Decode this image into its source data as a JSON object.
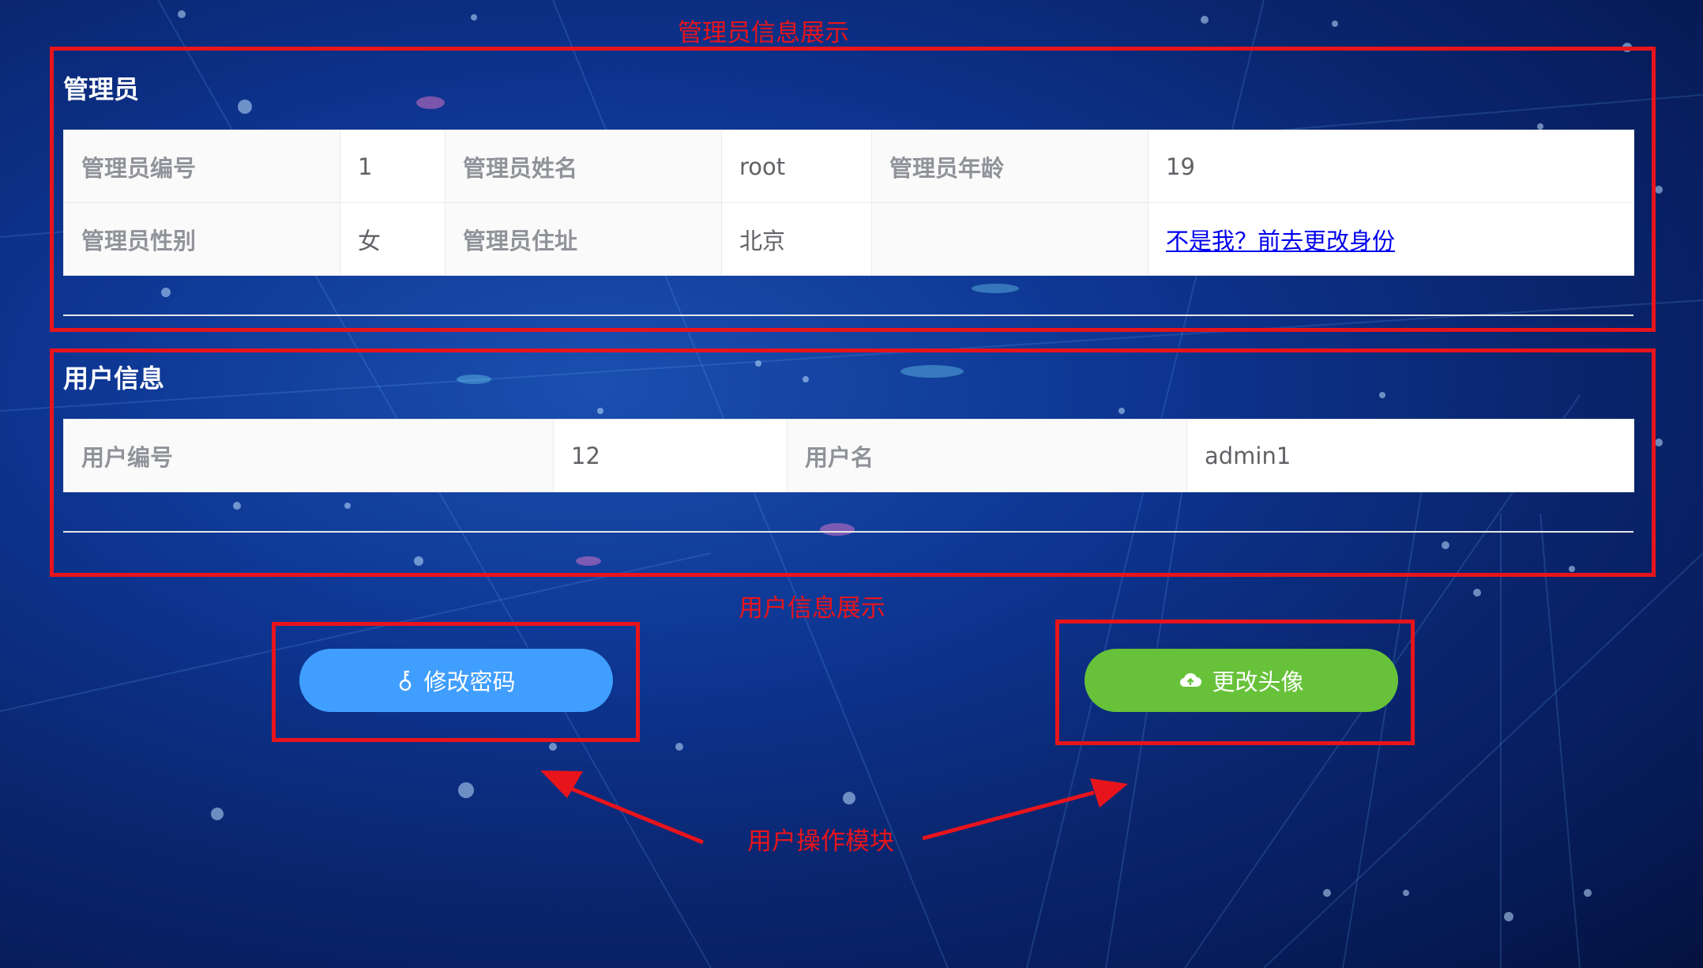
{
  "annotations": {
    "admin_display": "管理员信息展示",
    "user_display": "用户信息展示",
    "user_ops": "用户操作模块"
  },
  "admin": {
    "title": "管理员",
    "id_label": "管理员编号",
    "id_value": "1",
    "name_label": "管理员姓名",
    "name_value": "root",
    "age_label": "管理员年龄",
    "age_value": "19",
    "gender_label": "管理员性别",
    "gender_value": "女",
    "address_label": "管理员住址",
    "address_value": "北京",
    "switch_link": "不是我？前去更改身份"
  },
  "user": {
    "title": "用户信息",
    "id_label": "用户编号",
    "id_value": "12",
    "name_label": "用户名",
    "name_value": "admin1"
  },
  "actions": {
    "change_password": "修改密码",
    "change_avatar": "更改头像"
  },
  "icons": {
    "password": "key-icon",
    "avatar": "cloud-upload-icon"
  },
  "colors": {
    "annotation_red": "#e8141c",
    "primary_blue": "#409eff",
    "success_green": "#67c23a",
    "link_blue": "#0000ee"
  }
}
